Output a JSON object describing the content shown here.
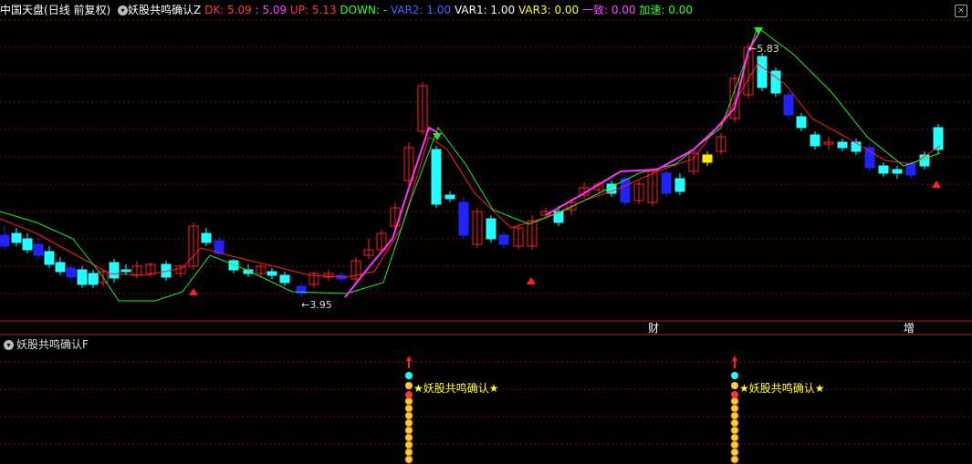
{
  "header": {
    "stock_name": "中国天盘",
    "period": "(日线 前复权)",
    "indicator": "妖股共鸣确认Z",
    "values": [
      {
        "label": "DK: 5.09",
        "color": "#ff3c3c"
      },
      {
        "label": ": 5.09",
        "color": "#ff44ff"
      },
      {
        "label": "UP: 5.13",
        "color": "#ff3c3c"
      },
      {
        "label": "DOWN: -",
        "color": "#33ff33"
      },
      {
        "label": "VAR2: 1.00",
        "color": "#4466ff"
      },
      {
        "label": "VAR1: 1.00",
        "color": "#ffffff"
      },
      {
        "label": "VAR3: 0.00",
        "color": "#ffff33"
      },
      {
        "label": "一致: 0.00",
        "color": "#ff44ff"
      },
      {
        "label": "加速: 0.00",
        "color": "#33ff33"
      }
    ]
  },
  "main": {
    "high_label": "5.83",
    "low_label": "3.95",
    "tags": [
      {
        "text": "财",
        "bg": "#1e3c8c"
      },
      {
        "text": "增",
        "bg": "#8c1e1e"
      }
    ]
  },
  "sub": {
    "title": "妖股共鸣确认F",
    "signals": [
      {
        "text": "★妖股共鸣确认★"
      },
      {
        "text": "★妖股共鸣确认★"
      }
    ]
  },
  "colors": {
    "up": "#ff2020",
    "down_cyan": "#22ffff",
    "down_blue": "#2222ff",
    "green": "#00ee00",
    "grid": "#801010",
    "ma_red": "#ff2020",
    "ma_green": "#22ee22",
    "trend": "#ff33ff"
  },
  "icons": {
    "collapse": "chevron-circle-icon",
    "close": "close-icon"
  }
}
